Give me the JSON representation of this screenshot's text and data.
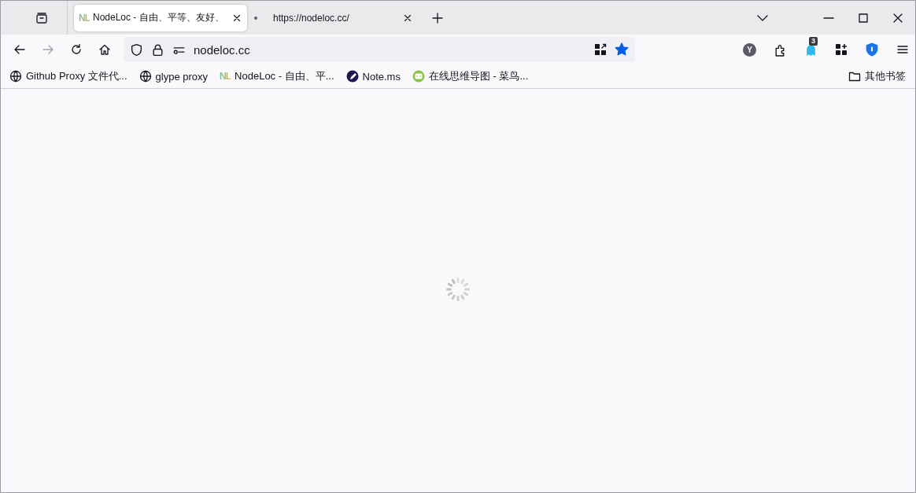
{
  "tabs": [
    {
      "title": "NodeLoc - 自由、平等、友好、",
      "logo": "NL",
      "selected": true
    },
    {
      "title": "https://nodeloc.cc/",
      "selected": false
    }
  ],
  "address_bar": {
    "url": "nodeloc.cc",
    "bookmarked": true
  },
  "extensions": {
    "avatar_letter": "Y",
    "badge": "3"
  },
  "bookmarks": [
    {
      "kind": "globe",
      "label": "Github Proxy 文件代..."
    },
    {
      "kind": "globe",
      "label": "glype proxy"
    },
    {
      "kind": "logo",
      "logo": "NL",
      "label": "NodeLoc - 自由、平..."
    },
    {
      "kind": "note",
      "label": "Note.ms"
    },
    {
      "kind": "code",
      "label": "在线思维导图 - 菜鸟..."
    }
  ],
  "other_bookmarks": "其他书签"
}
